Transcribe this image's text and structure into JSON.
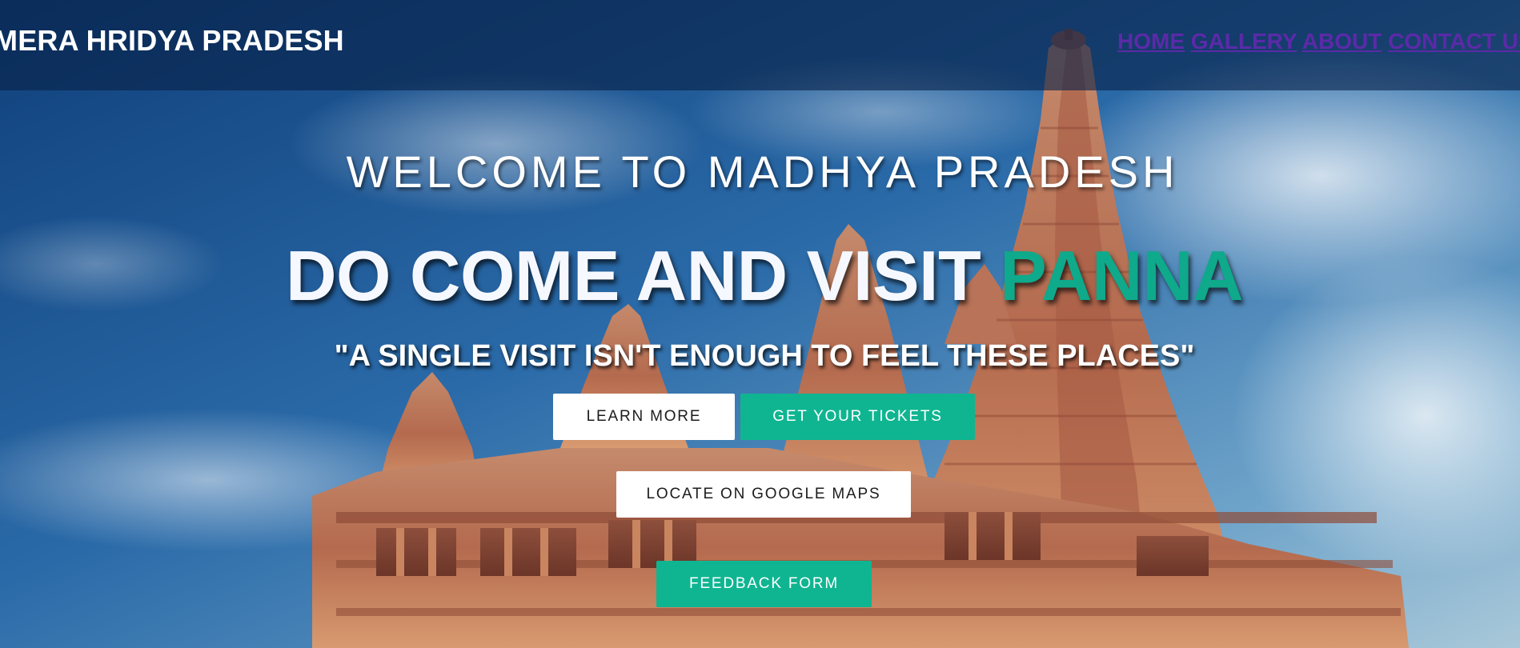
{
  "header": {
    "brand": "MERA HRIDYA PRADESH",
    "nav": [
      {
        "label": "HOME"
      },
      {
        "label": "GALLERY"
      },
      {
        "label": "ABOUT"
      },
      {
        "label": "CONTACT US"
      }
    ]
  },
  "hero": {
    "welcome": "WELCOME TO MADHYA PRADESH",
    "headline_prefix": "DO COME AND VISIT",
    "headline_accent": "PANNA",
    "tagline": "\"A SINGLE VISIT ISN'T ENOUGH TO FEEL THESE PLACES\""
  },
  "buttons": {
    "learn_more": "LEARN MORE",
    "tickets": "GET YOUR TICKETS",
    "maps": "LOCATE ON GOOGLE MAPS",
    "feedback": "FEEDBACK FORM"
  },
  "colors": {
    "accent": "#0fb591",
    "nav_link": "#5b2aa8",
    "header_bg": "#082248"
  }
}
